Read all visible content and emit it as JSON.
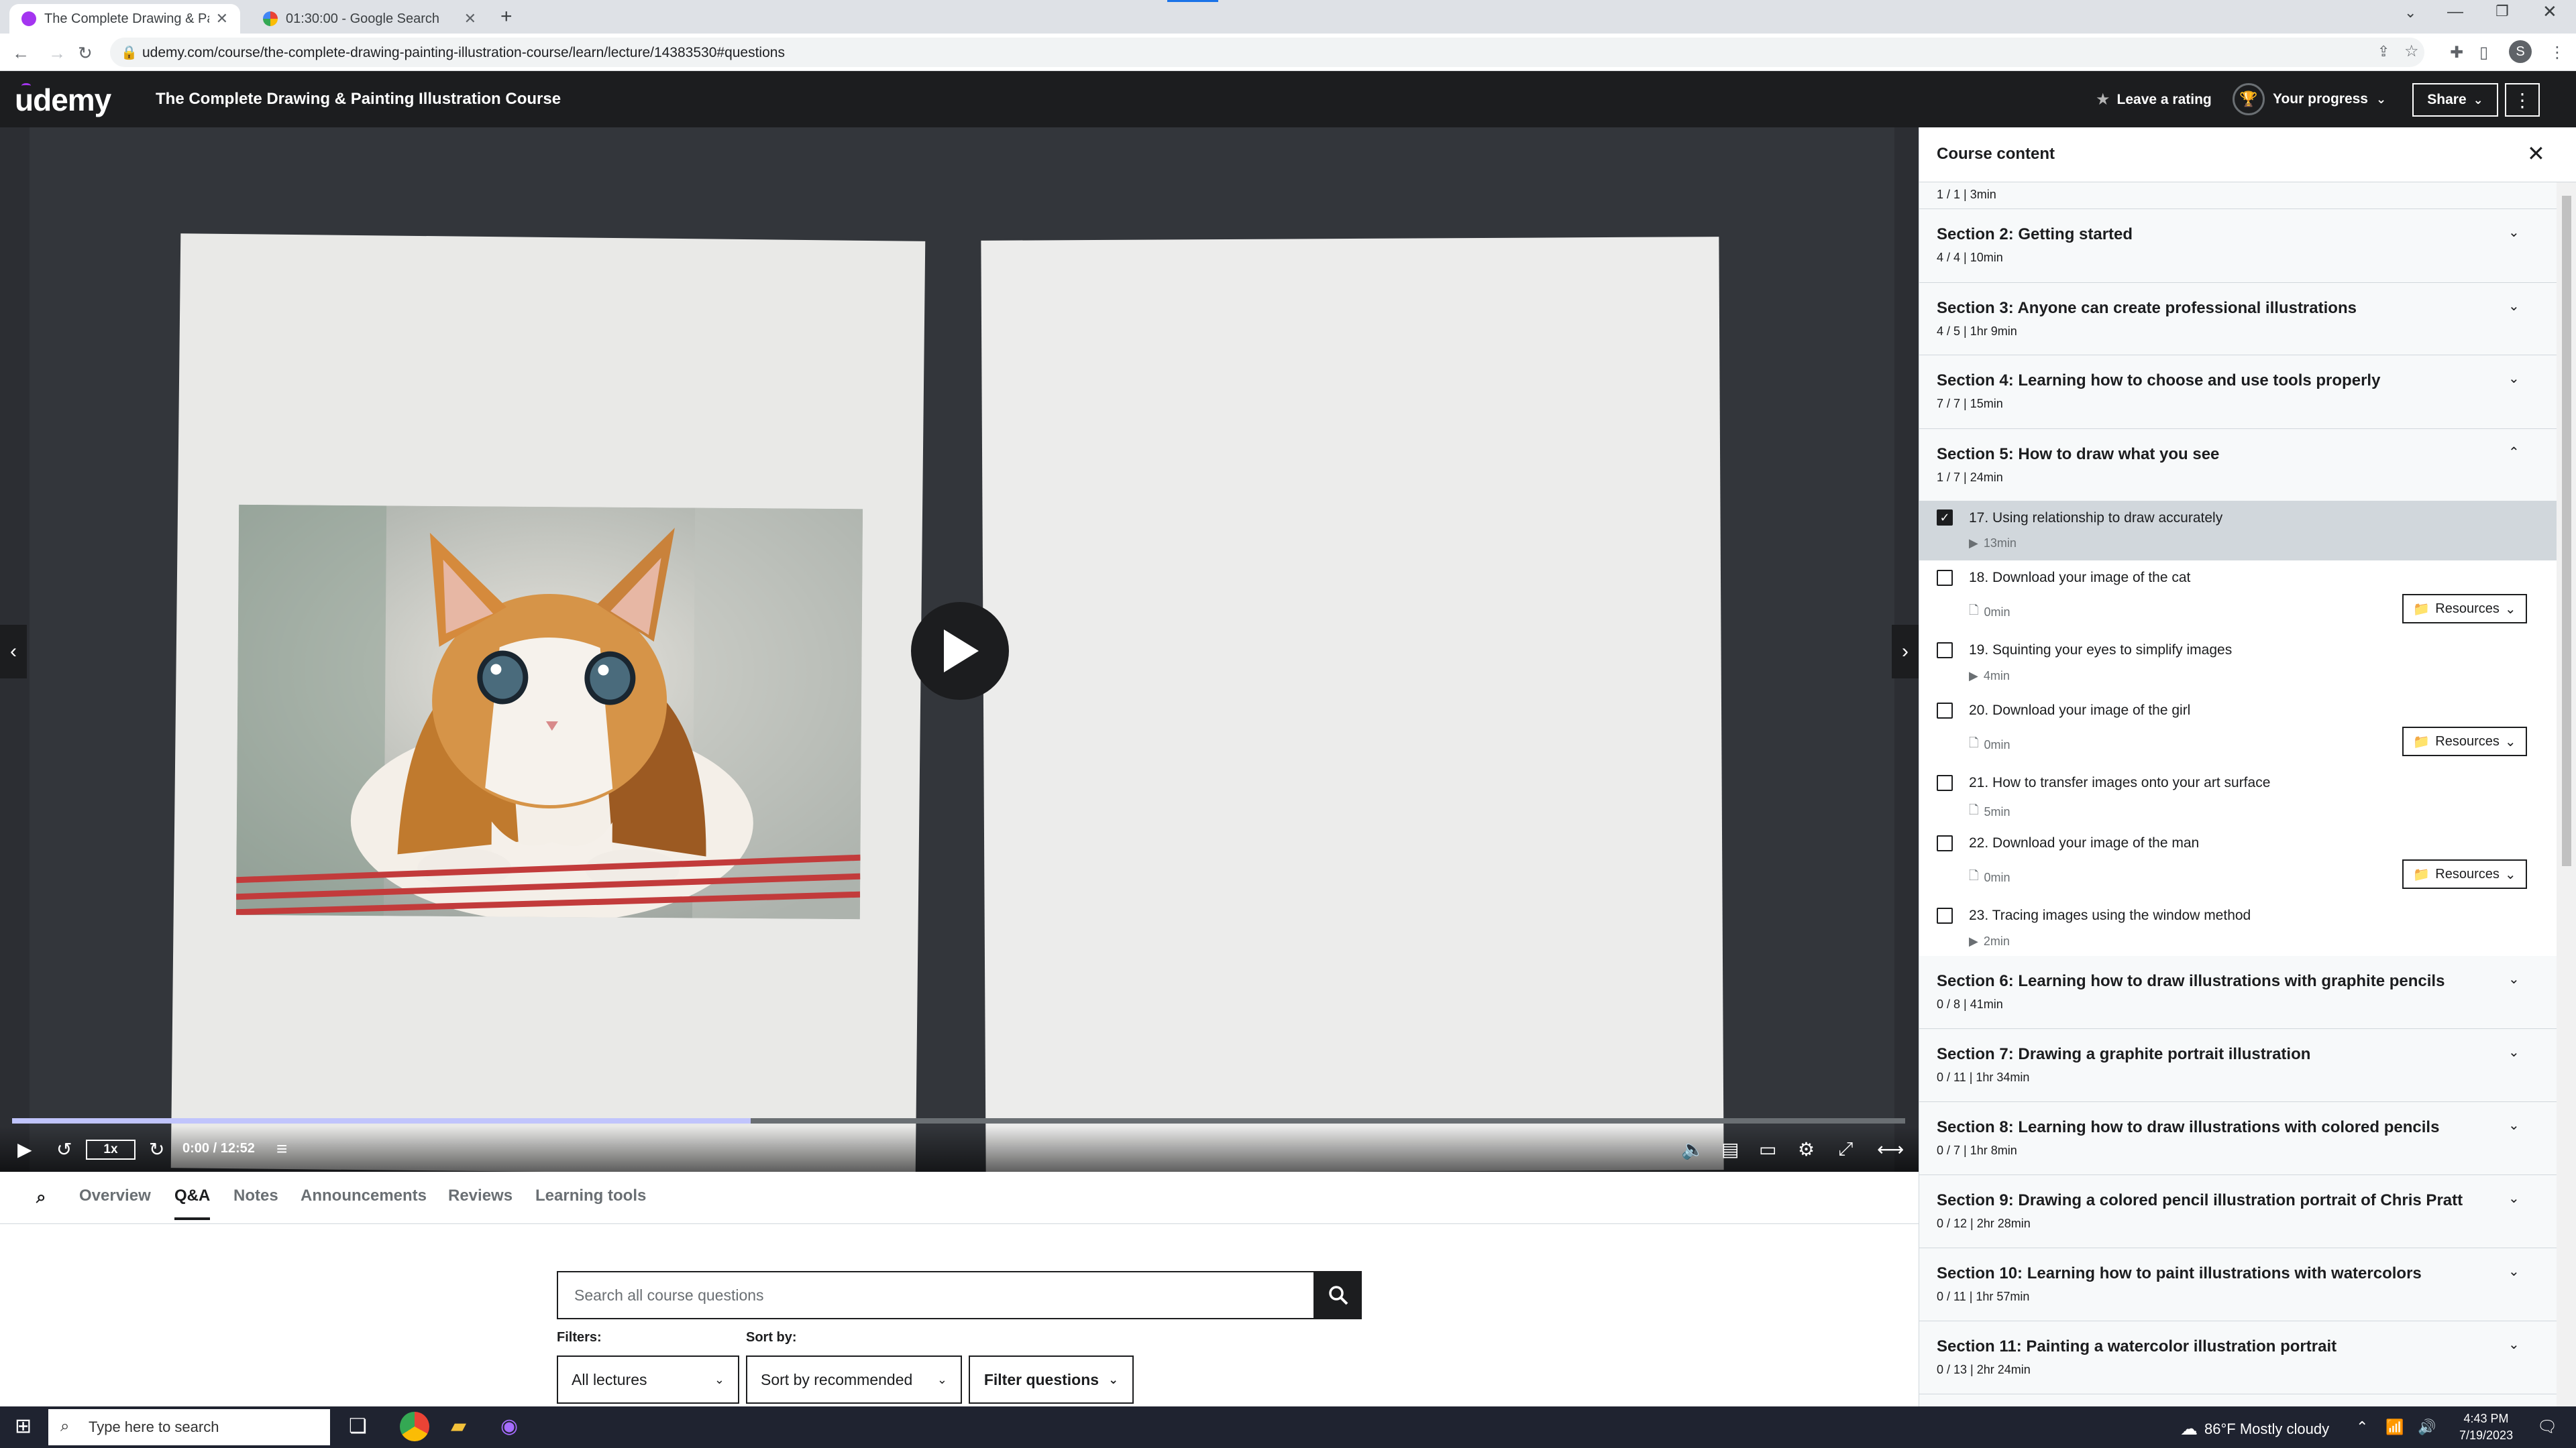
{
  "browser": {
    "tabs": [
      {
        "title": "The Complete Drawing & Paintin",
        "active": true
      },
      {
        "title": "01:30:00 - Google Search",
        "active": false
      }
    ],
    "url": "udemy.com/course/the-complete-drawing-painting-illustration-course/learn/lecture/14383530#questions",
    "profile_initial": "S"
  },
  "header": {
    "logo": "udemy",
    "course_title": "The Complete Drawing & Painting Illustration Course",
    "leave_rating": "Leave a rating",
    "your_progress": "Your progress",
    "share": "Share"
  },
  "player": {
    "speed": "1x",
    "time": "0:00 / 12:52",
    "progress_fraction": 0.39
  },
  "subnav": {
    "tabs": [
      "Overview",
      "Q&A",
      "Notes",
      "Announcements",
      "Reviews",
      "Learning tools"
    ],
    "active": "Q&A"
  },
  "qa": {
    "search_placeholder": "Search all course questions",
    "filters_label": "Filters:",
    "sortby_label": "Sort by:",
    "filter_value": "All lectures",
    "sort_value": "Sort by recommended",
    "filter_questions": "Filter questions"
  },
  "sidebar": {
    "title": "Course content",
    "partial_meta": "1 / 1 | 3min",
    "sections_before": [
      {
        "title": "Section 2: Getting started",
        "meta": "4 / 4 | 10min"
      },
      {
        "title": "Section 3: Anyone can create professional illustrations",
        "meta": "4 / 5 | 1hr 9min"
      },
      {
        "title": "Section 4: Learning how to choose and use tools properly",
        "meta": "7 / 7 | 15min"
      }
    ],
    "open_section": {
      "title": "Section 5: How to draw what you see",
      "meta": "1 / 7 | 24min"
    },
    "lectures": [
      {
        "title": "17. Using relationship to draw accurately",
        "meta": "13min",
        "type": "video",
        "checked": true,
        "current": true,
        "resources": ""
      },
      {
        "title": "18. Download your image of the cat",
        "meta": "0min",
        "type": "file",
        "checked": false,
        "current": false,
        "resources": "Resources"
      },
      {
        "title": "19. Squinting your eyes to simplify images",
        "meta": "4min",
        "type": "video",
        "checked": false,
        "current": false,
        "resources": ""
      },
      {
        "title": "20. Download your image of the girl",
        "meta": "0min",
        "type": "file",
        "checked": false,
        "current": false,
        "resources": "Resources"
      },
      {
        "title": "21. How to transfer images onto your art surface",
        "meta": "5min",
        "type": "file",
        "checked": false,
        "current": false,
        "resources": ""
      },
      {
        "title": "22. Download your image of the man",
        "meta": "0min",
        "type": "file",
        "checked": false,
        "current": false,
        "resources": "Resources"
      },
      {
        "title": "23. Tracing images using the window method",
        "meta": "2min",
        "type": "video",
        "checked": false,
        "current": false,
        "resources": ""
      }
    ],
    "sections_after": [
      {
        "title": "Section 6: Learning how to draw illustrations with graphite pencils",
        "meta": "0 / 8 | 41min"
      },
      {
        "title": "Section 7: Drawing a graphite portrait illustration",
        "meta": "0 / 11 | 1hr 34min"
      },
      {
        "title": "Section 8: Learning how to draw illustrations with colored pencils",
        "meta": "0 / 7 | 1hr 8min"
      },
      {
        "title": "Section 9: Drawing a colored pencil illustration portrait of Chris Pratt",
        "meta": "0 / 12 | 2hr 28min"
      },
      {
        "title": "Section 10: Learning how to paint illustrations with watercolors",
        "meta": "0 / 11 | 1hr 57min"
      },
      {
        "title": "Section 11: Painting a watercolor illustration portrait",
        "meta": "0 / 13 | 2hr 24min"
      }
    ]
  },
  "taskbar": {
    "search_placeholder": "Type here to search",
    "weather": "86°F  Mostly cloudy",
    "time": "4:43 PM",
    "date": "7/19/2023"
  },
  "colors": {
    "udemy_dark": "#1c1d1f",
    "udemy_purple": "#a435f0",
    "progress_fill": "#c0c4fc"
  }
}
